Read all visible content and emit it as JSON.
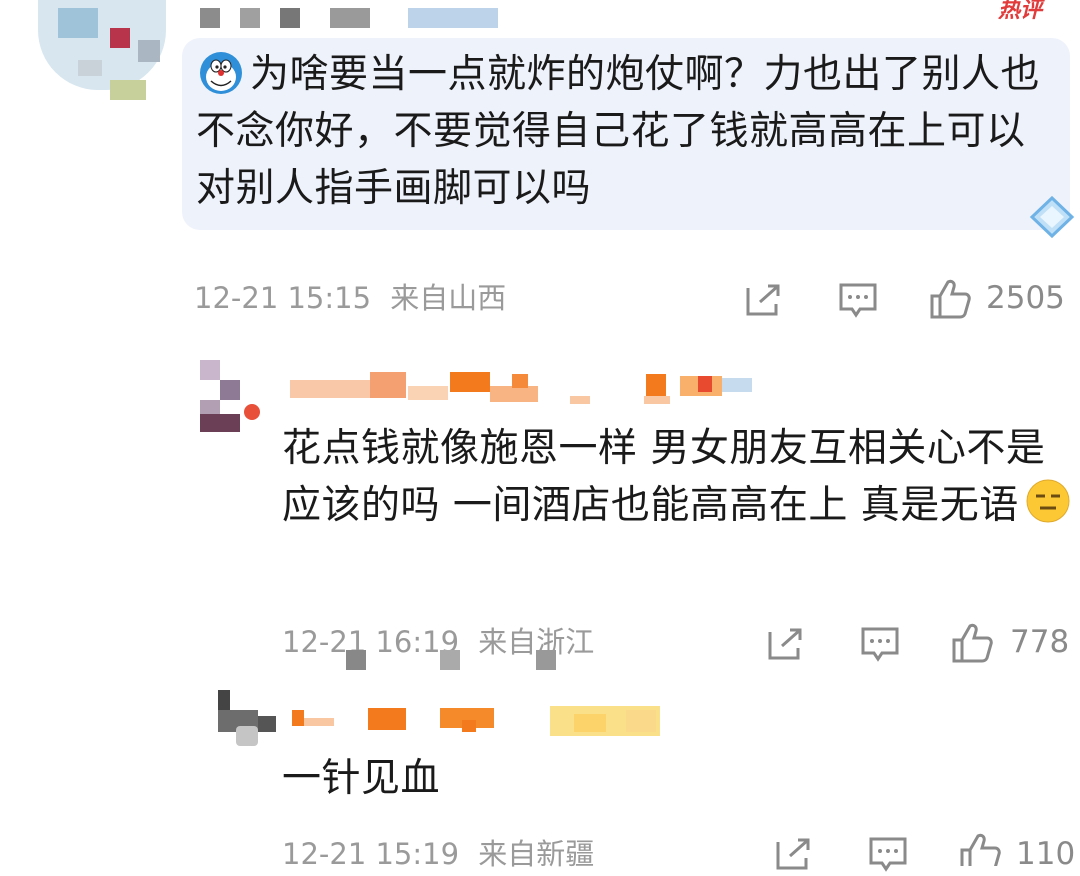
{
  "post": {
    "hot_badge": "热评",
    "text": "为啥要当一点就炸的炮仗啊？力也出了别人也不念你好，不要觉得自己花了钱就高高在上可以对别人指手画脚可以吗",
    "timestamp": "12-21 15:15",
    "location": "来自山西",
    "like_count": "2505",
    "author_icon": "doraemon-emoji-icon"
  },
  "replies": [
    {
      "text": "花点钱就像施恩一样  男女朋友互相关心不是应该的吗  一间酒店也能高高在上  真是无语",
      "emoji": "expressionless-face-emoji",
      "timestamp": "12-21 16:19",
      "location": "来自浙江",
      "like_count": "778"
    },
    {
      "text": "一针见血",
      "timestamp": "12-21 15:19",
      "location": "来自新疆",
      "like_count": "110"
    }
  ],
  "icons": {
    "share": "share-icon",
    "comment": "comment-icon",
    "like": "thumbs-up-icon"
  },
  "colors": {
    "bubble_bg": "#eef2fb",
    "meta_gray": "#9a9a9a",
    "text": "#1a1a1a",
    "hot_red": "#e23b3b",
    "censor_orange": "#f47a1e"
  }
}
